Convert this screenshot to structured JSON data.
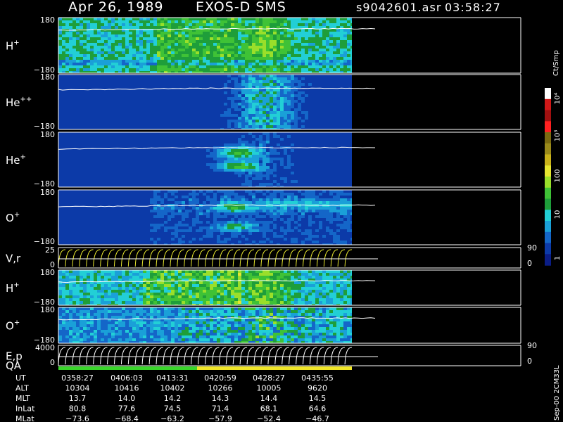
{
  "header": {
    "date": "Apr 26, 1989",
    "instrument": "EXOS-D SMS",
    "file": "s9042601.asr",
    "time": "03:58:27"
  },
  "colorbar": {
    "unit": "Ct/Smp",
    "ticks": [
      "10⁴",
      "10³",
      "100",
      "10",
      "1"
    ]
  },
  "footer": {
    "stamp": "Sep-00 2CM33L"
  },
  "chart_data": {
    "type": "heatmap",
    "panels": [
      {
        "label": "H",
        "sup": "+",
        "ymax": "180",
        "ymin": "−180",
        "kind": "spectro",
        "overlay": 0.2
      },
      {
        "label": "He",
        "sup": "++",
        "ymax": "180",
        "ymin": "−180",
        "kind": "spectro",
        "overlay": 0.25
      },
      {
        "label": "He",
        "sup": "+",
        "ymax": "180",
        "ymin": "−180",
        "kind": "spectro",
        "overlay": 0.28
      },
      {
        "label": "O",
        "sup": "+",
        "ymax": "180",
        "ymin": "−180",
        "kind": "spectro",
        "overlay": 0.28
      },
      {
        "label": "V,r",
        "sup": "",
        "ymax": "25",
        "ymin": "0",
        "rmax": "90",
        "rmin": "0",
        "kind": "lines"
      },
      {
        "label": "H",
        "sup": "+",
        "ymax": "180",
        "ymin": "−180",
        "kind": "spectro",
        "overlay": 0.3
      },
      {
        "label": "O",
        "sup": "+",
        "ymax": "180",
        "ymin": "−180",
        "kind": "spectro",
        "overlay": 0.3
      },
      {
        "label": "E,p",
        "sup": "",
        "ymax": "4000",
        "ymin": "0",
        "rmax": "90",
        "rmin": "0",
        "kind": "lines"
      }
    ],
    "qa_label": "QA",
    "table": {
      "rows": [
        {
          "name": "UT",
          "values": [
            "0358:27",
            "0406:03",
            "0413:31",
            "0420:59",
            "0428:27",
            "0435:55"
          ]
        },
        {
          "name": "ALT",
          "values": [
            "10304",
            "10416",
            "10402",
            "10266",
            "10005",
            "9620"
          ]
        },
        {
          "name": "MLT",
          "values": [
            "13.7",
            "14.0",
            "14.2",
            "14.3",
            "14.4",
            "14.5"
          ]
        },
        {
          "name": "InLat",
          "values": [
            "80.8",
            "77.6",
            "74.5",
            "71.4",
            "68.1",
            "64.6"
          ]
        },
        {
          "name": "MLat",
          "values": [
            "−73.6",
            "−68.4",
            "−63.2",
            "−57.9",
            "−52.4",
            "−46.7"
          ]
        }
      ]
    }
  }
}
